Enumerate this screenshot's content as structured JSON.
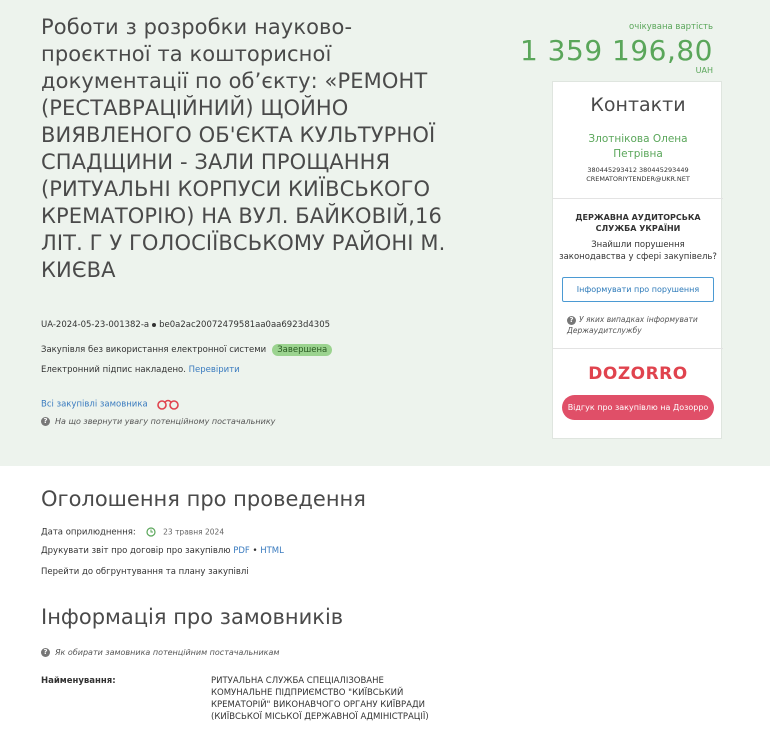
{
  "header": {
    "title": "Роботи з розробки науково-проєктної та кошторисної документації по об’єкту: «РЕМОНТ (РЕСТАВРАЦІЙНИЙ) ЩОЙНО ВИЯВЛЕНОГО ОБ'ЄКТА КУЛЬТУРНОЇ СПАДЩИНИ - ЗАЛИ ПРОЩАННЯ (РИТУАЛЬНІ КОРПУСИ КИЇВСЬКОГО КРЕМАТОРІЮ) НА ВУЛ. БАЙКОВІЙ,16 ЛІТ. Г У ГОЛОСІЇВСЬКОМУ РАЙОНІ М. КИЄВА",
    "tender_id": "UA-2024-05-23-001382-a",
    "tender_hash": "be0a2ac20072479581aa0aa6923d4305",
    "procedure_type": "Закупівля без використання електронної системи",
    "status": "Завершена",
    "signature_text": "Електронний підпис накладено.",
    "signature_link": "Перевірити",
    "buyer_purchases_link": "Всі закупівлі замовника",
    "attention_hint": "На що звернути увагу потенційному постачальнику",
    "expected_value_label": "очікувана вартість",
    "expected_value": "1 359 196,80",
    "currency": "UAH"
  },
  "contacts": {
    "title": "Контакти",
    "name_line1": "Злотнікова Олена",
    "name_line2": "Петрівна",
    "phones": "380445293412 380445293449",
    "email": "CREMATORIYTENDER@UKR.NET",
    "audit_title": "ДЕРЖАВНА АУДИТОРСЬКА СЛУЖБА УКРАЇНИ",
    "audit_text": "Знайшли порушення законодавства у сфері закупівель?",
    "report_button": "Інформувати про порушення",
    "audit_hint": "У яких випадках інформувати Держаудитслужбу",
    "dozorro_logo": "DOZORRO",
    "dozorro_button": "Відгук про закупівлю на Дозорро"
  },
  "announcement": {
    "title": "Оголошення про проведення",
    "published_label": "Дата оприлюднення:",
    "published_date": "23 травня 2024",
    "print_label": "Друкувати звіт про договір про закупівлю",
    "pdf": "PDF",
    "html": "HTML",
    "plan_link": "Перейти до обгрунтування та плану закупівлі"
  },
  "buyers": {
    "title": "Інформація про замовників",
    "hint": "Як обирати замовника потенційним постачальникам",
    "name_label": "Найменування:",
    "name_value": "РИТУАЛЬНА СЛУЖБА СПЕЦІАЛІЗОВАНЕ КОМУНАЛЬНЕ ПІДПРИЄМСТВО \"КИЇВСЬКИЙ КРЕМАТОРІЙ\" ВИКОНАВЧОГО ОРГАНУ КИЇВРАДИ (КИЇВСЬКОЇ МІСЬКОЇ ДЕРЖАВНОЇ АДМІНІСТРАЦІЇ)"
  },
  "colors": {
    "accent_green": "#5aa65a",
    "link_blue": "#3a7bbf",
    "dozorro_red": "#e0434e",
    "header_bg": "#edf3ed"
  }
}
